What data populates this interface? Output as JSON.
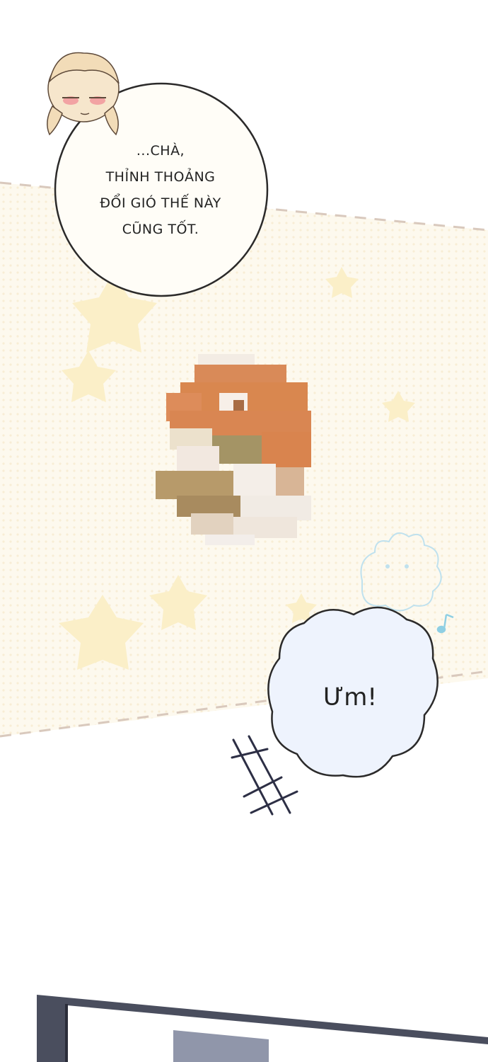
{
  "panel": {
    "background_color": "#ffffff",
    "band_color": "#fdf9ec",
    "star_color": "#fbeec4",
    "dash_color": "#d9c9bd",
    "bubble_fill_1": "#fffdf7",
    "bubble_fill_2": "#eef3fd",
    "outline_color": "#2b2a2a"
  },
  "speech_bubble_1": {
    "lines": [
      "...CHÀ,",
      "THỈNH THOẢNG",
      "ĐỔI GIÓ THẾ NÀY",
      "CŨNG TỐT."
    ]
  },
  "speech_bubble_2": {
    "text": "Ưm!"
  },
  "icons": {
    "sfx_scribble": "scribble-icon",
    "music_note": "music-note-icon",
    "censored_object": "pixelated-object",
    "chibi": "chibi-character"
  }
}
